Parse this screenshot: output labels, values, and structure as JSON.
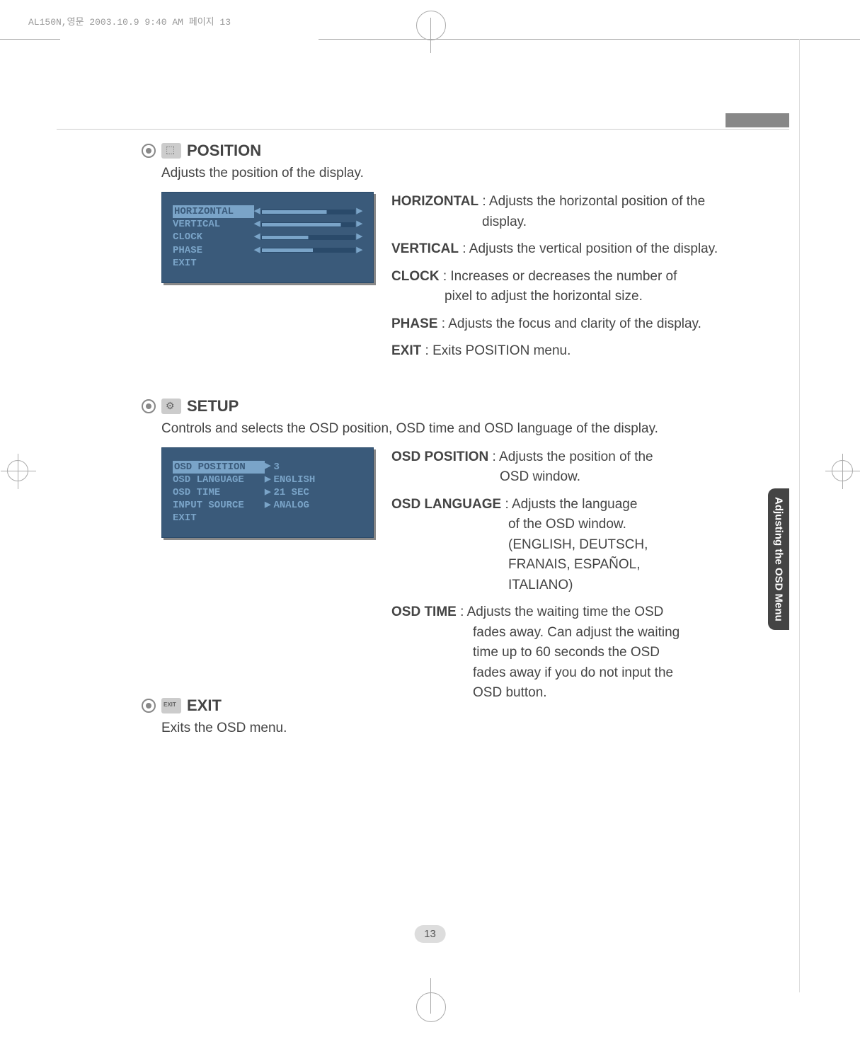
{
  "print_header": "AL150N,영문  2003.10.9 9:40 AM  페이지 13",
  "page_number": "13",
  "side_tab": "Adjusting the OSD Menu",
  "sections": {
    "position": {
      "title": "POSITION",
      "desc": "Adjusts the position of the display.",
      "osd": {
        "items": [
          {
            "label": "HORIZONTAL",
            "selected": true,
            "fill": "70%"
          },
          {
            "label": "VERTICAL",
            "selected": false,
            "fill": "85%"
          },
          {
            "label": "CLOCK",
            "selected": false,
            "fill": "50%"
          },
          {
            "label": "PHASE",
            "selected": false,
            "fill": "55%"
          },
          {
            "label": "EXIT",
            "selected": false,
            "fill": null
          }
        ]
      },
      "defs": [
        {
          "term": "HORIZONTAL",
          "sep": " : ",
          "text1": "Adjusts the horizontal position of the",
          "text2": "display.",
          "cont": "hpos"
        },
        {
          "term": "VERTICAL",
          "sep": " : ",
          "text1": "Adjusts the vertical position of the display."
        },
        {
          "term": "CLOCK",
          "sep": " : ",
          "text1": "Increases or decreases the number of",
          "text2": "pixel to adjust the horizontal size.",
          "cont": "clock"
        },
        {
          "term": "PHASE",
          "sep": " : ",
          "text1": "Adjusts the focus and clarity of the display."
        },
        {
          "term": "EXIT",
          "sep": " : ",
          "text1": "Exits POSITION menu."
        }
      ]
    },
    "setup": {
      "title": "SETUP",
      "desc": "Controls and selects the OSD position, OSD time and OSD language of the display.",
      "osd": {
        "items": [
          {
            "label": "OSD POSITION",
            "selected": true,
            "value": "3"
          },
          {
            "label": "OSD LANGUAGE",
            "selected": false,
            "value": "ENGLISH"
          },
          {
            "label": "OSD TIME",
            "selected": false,
            "value": "21 SEC"
          },
          {
            "label": "INPUT SOURCE",
            "selected": false,
            "value": "ANALOG"
          },
          {
            "label": "EXIT",
            "selected": false,
            "value": null
          }
        ]
      },
      "defs": [
        {
          "term": "OSD POSITION",
          "sep": " : ",
          "text1": "Adjusts the position of the",
          "text2": "OSD window.",
          "cont": "osdpos"
        },
        {
          "term": "OSD LANGUAGE",
          "sep": " : ",
          "text1": "Adjusts the language",
          "lines": [
            "of the OSD window.",
            "(ENGLISH, DEUTSCH,",
            "FRANAIS, ESPAÑOL,",
            "ITALIANO)"
          ],
          "cont": "lang"
        },
        {
          "term": "OSD TIME",
          "sep": " : ",
          "text1": "Adjusts the waiting time the OSD",
          "lines": [
            "fades away. Can adjust the waiting",
            "time up to 60 seconds the OSD",
            "fades away if you do not input the",
            "OSD button."
          ],
          "cont": "time"
        }
      ]
    },
    "exit": {
      "title": "EXIT",
      "desc": "Exits the OSD menu."
    }
  }
}
